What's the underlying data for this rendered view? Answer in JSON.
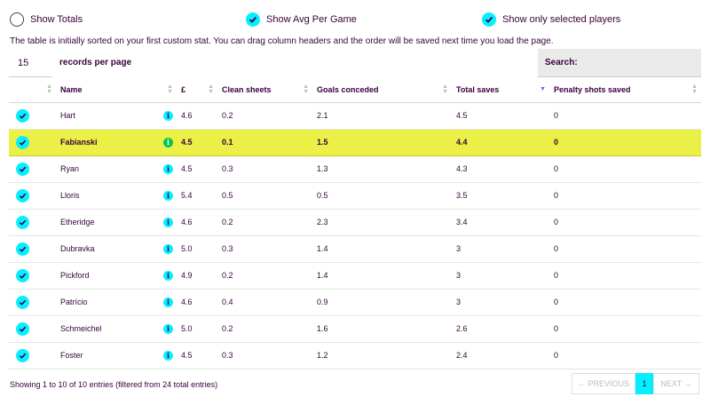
{
  "options": {
    "show_totals": "Show Totals",
    "show_avg": "Show Avg Per Game",
    "show_selected": "Show only selected players"
  },
  "note": "The table is initially sorted on your first custom stat. You can drag column headers and the order will be saved next time you load the page.",
  "records": {
    "value": "15",
    "label": "records per page"
  },
  "search": {
    "label": "Search:"
  },
  "columns": [
    "Name",
    "£",
    "Clean sheets",
    "Goals conceded",
    "Total saves",
    "Penalty shots saved"
  ],
  "rows": [
    [
      "Hart",
      "4.6",
      "0.2",
      "2.1",
      "4.5",
      "0"
    ],
    [
      "Fabianski",
      "4.5",
      "0.1",
      "1.5",
      "4.4",
      "0"
    ],
    [
      "Ryan",
      "4.5",
      "0.3",
      "1.3",
      "4.3",
      "0"
    ],
    [
      "Lloris",
      "5.4",
      "0.5",
      "0.5",
      "3.5",
      "0"
    ],
    [
      "Etheridge",
      "4.6",
      "0.2",
      "2.3",
      "3.4",
      "0"
    ],
    [
      "Dubravka",
      "5.0",
      "0.3",
      "1.4",
      "3",
      "0"
    ],
    [
      "Pickford",
      "4.9",
      "0.2",
      "1.4",
      "3",
      "0"
    ],
    [
      "Patrício",
      "4.6",
      "0.4",
      "0.9",
      "3",
      "0"
    ],
    [
      "Schmeichel",
      "5.0",
      "0.2",
      "1.6",
      "2.6",
      "0"
    ],
    [
      "Foster",
      "4.5",
      "0.3",
      "1.2",
      "2.4",
      "0"
    ]
  ],
  "info_glyph": "i",
  "footer": "Showing 1 to 10 of 10 entries (filtered from 24 total entries)",
  "pager": {
    "prev": "← PREVIOUS",
    "current": "1",
    "next": "NEXT →"
  },
  "colors": {
    "accent": "#05f0ff",
    "highlight": "#ebf046",
    "text": "#37003c"
  },
  "icons": {
    "selected": "check-icon",
    "info": "info-icon"
  }
}
